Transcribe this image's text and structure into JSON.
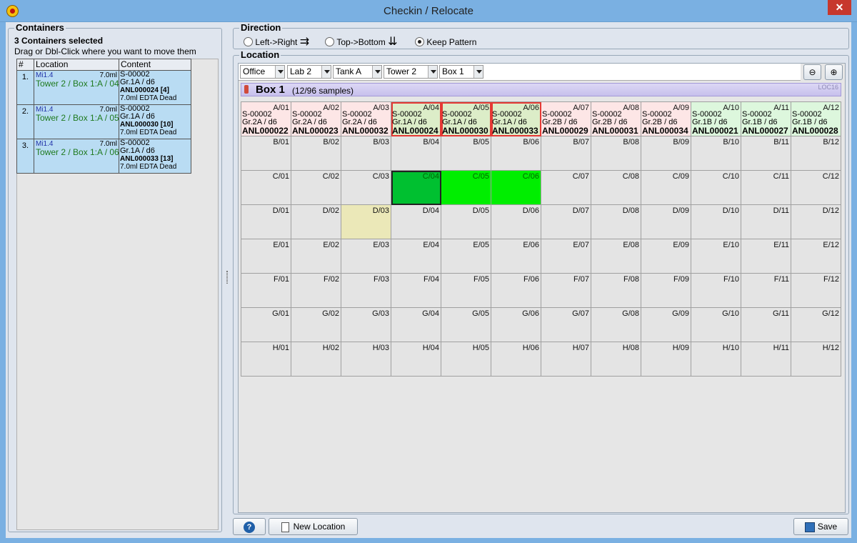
{
  "window": {
    "title": "Checkin / Relocate",
    "close": "✕"
  },
  "containers": {
    "legend": "Containers",
    "selected": "3 Containers selected",
    "hint": "Drag or Dbl-Click where you want to move them",
    "columns": [
      "#",
      "Location",
      "Content"
    ],
    "rows": [
      {
        "num": "1.",
        "code": "Mi1.4",
        "vol": "7.0ml",
        "loc": "Tower 2 / Box 1:A / 04",
        "sample": "S-00002",
        "group": "Gr.1A / d6",
        "id": "ANL000024 [4]",
        "desc": "7.0ml EDTA Dead"
      },
      {
        "num": "2.",
        "code": "Mi1.4",
        "vol": "7.0ml",
        "loc": "Tower 2 / Box 1:A / 05",
        "sample": "S-00002",
        "group": "Gr.1A / d6",
        "id": "ANL000030 [10]",
        "desc": "7.0ml EDTA Dead"
      },
      {
        "num": "3.",
        "code": "Mi1.4",
        "vol": "7.0ml",
        "loc": "Tower 2 / Box 1:A / 06",
        "sample": "S-00002",
        "group": "Gr.1A / d6",
        "id": "ANL000033 [13]",
        "desc": "7.0ml EDTA Dead"
      }
    ]
  },
  "direction": {
    "legend": "Direction",
    "options": [
      "Left->Right",
      "Top->Bottom",
      "Keep Pattern"
    ],
    "selected": "Keep Pattern"
  },
  "location": {
    "legend": "Location",
    "path": [
      "Office",
      "Lab 2",
      "Tank A",
      "Tower 2",
      "Box 1"
    ],
    "box_title": "Box 1",
    "box_count": "(12/96 samples)",
    "box_code": "LOC16",
    "row_labels": [
      "A",
      "B",
      "C",
      "D",
      "E",
      "F",
      "G",
      "H"
    ],
    "col_labels": [
      "01",
      "02",
      "03",
      "04",
      "05",
      "06",
      "07",
      "08",
      "09",
      "10",
      "11",
      "12"
    ],
    "row_a": [
      {
        "sample": "S-00002",
        "group": "Gr.2A / d6",
        "id": "ANL000022",
        "state": "pink"
      },
      {
        "sample": "S-00002",
        "group": "Gr.2A / d6",
        "id": "ANL000023",
        "state": "pink"
      },
      {
        "sample": "S-00002",
        "group": "Gr.2A / d6",
        "id": "ANL000032",
        "state": "pink"
      },
      {
        "sample": "S-00002",
        "group": "Gr.1A / d6",
        "id": "ANL000024",
        "state": "sel"
      },
      {
        "sample": "S-00002",
        "group": "Gr.1A / d6",
        "id": "ANL000030",
        "state": "sel"
      },
      {
        "sample": "S-00002",
        "group": "Gr.1A / d6",
        "id": "ANL000033",
        "state": "sel"
      },
      {
        "sample": "S-00002",
        "group": "Gr.2B / d6",
        "id": "ANL000029",
        "state": "pink"
      },
      {
        "sample": "S-00002",
        "group": "Gr.2B / d6",
        "id": "ANL000031",
        "state": "pink"
      },
      {
        "sample": "S-00002",
        "group": "Gr.2B / d6",
        "id": "ANL000034",
        "state": "pink"
      },
      {
        "sample": "S-00002",
        "group": "Gr.1B / d6",
        "id": "ANL000021",
        "state": "green"
      },
      {
        "sample": "S-00002",
        "group": "Gr.1B / d6",
        "id": "ANL000027",
        "state": "green"
      },
      {
        "sample": "S-00002",
        "group": "Gr.1B / d6",
        "id": "ANL000028",
        "state": "green"
      }
    ],
    "targets": [
      "C/04",
      "C/05",
      "C/06"
    ],
    "hover": "D/03"
  },
  "buttons": {
    "help": "?",
    "new_location": "New Location",
    "save": "Save"
  }
}
